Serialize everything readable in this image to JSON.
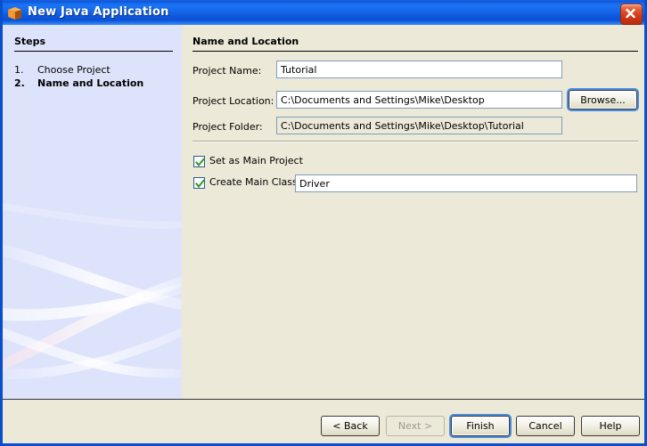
{
  "window": {
    "title": "New Java Application",
    "icon": "java-cube-icon",
    "close_label": "Close",
    "border_color": "#0a4ecb",
    "titlebar_color": "#1668ea",
    "panel_bg": "#ece9d8",
    "sidebar_bg": "#dde3fb"
  },
  "sidebar": {
    "heading": "Steps",
    "items": [
      {
        "number": "1.",
        "label": "Choose Project",
        "active": false
      },
      {
        "number": "2.",
        "label": "Name and Location",
        "active": true
      }
    ]
  },
  "panel": {
    "heading": "Name and Location",
    "fields": [
      {
        "label": "Project Name:",
        "value": "Tutorial",
        "readonly": false
      },
      {
        "label": "Project Location:",
        "value": "C:\\Documents and Settings\\Mike\\Desktop",
        "readonly": false
      },
      {
        "label": "Project Folder:",
        "value": "C:\\Documents and Settings\\Mike\\Desktop\\Tutorial",
        "readonly": true
      }
    ],
    "browse_label": "Browse...",
    "checkboxes": [
      {
        "label": "Set as Main Project",
        "checked": true
      },
      {
        "label": "Create Main Class",
        "checked": true
      }
    ],
    "main_class_value": "Driver",
    "checkmark_color": "#2f9e2f"
  },
  "buttonbar": {
    "buttons": [
      {
        "label": "< Back",
        "disabled": false,
        "default": false
      },
      {
        "label": "Next >",
        "disabled": true,
        "default": false
      },
      {
        "label": "Finish",
        "disabled": false,
        "default": true
      },
      {
        "label": "Cancel",
        "disabled": false,
        "default": false
      },
      {
        "label": "Help",
        "disabled": false,
        "default": false
      }
    ]
  }
}
